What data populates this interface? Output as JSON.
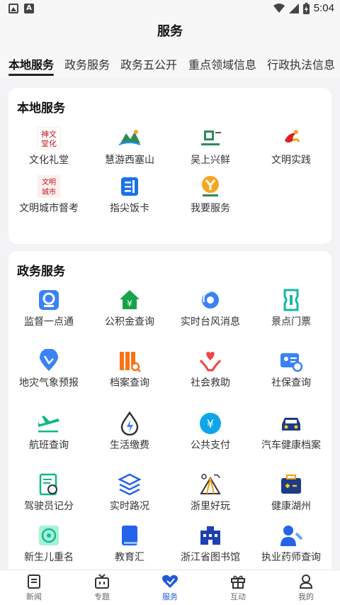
{
  "status": {
    "time": "5:04"
  },
  "header": {
    "title": "服务"
  },
  "tabs": [
    {
      "label": "本地服务"
    },
    {
      "label": "政务服务"
    },
    {
      "label": "政务五公开"
    },
    {
      "label": "重点领域信息"
    },
    {
      "label": "行政执法信息"
    }
  ],
  "local": {
    "title": "本地服务",
    "items": [
      {
        "label": "文化礼堂"
      },
      {
        "label": "慧游西塞山"
      },
      {
        "label": "吴上兴鲜"
      },
      {
        "label": "文明实践"
      },
      {
        "label": "文明城市督考"
      },
      {
        "label": "指尖饭卡"
      },
      {
        "label": "我要服务"
      }
    ]
  },
  "gov": {
    "title": "政务服务",
    "items": [
      {
        "label": "监督一点通"
      },
      {
        "label": "公积金查询"
      },
      {
        "label": "实时台风消息"
      },
      {
        "label": "景点门票"
      },
      {
        "label": "地灾气象预报"
      },
      {
        "label": "档案查询"
      },
      {
        "label": "社会救助"
      },
      {
        "label": "社保查询"
      },
      {
        "label": "航班查询"
      },
      {
        "label": "生活缴费"
      },
      {
        "label": "公共支付"
      },
      {
        "label": "汽车健康档案"
      },
      {
        "label": "驾驶员记分"
      },
      {
        "label": "实时路况"
      },
      {
        "label": "浙里好玩"
      },
      {
        "label": "健康湖州"
      },
      {
        "label": "新生儿重名"
      },
      {
        "label": "教育汇"
      },
      {
        "label": "浙江省图书馆"
      },
      {
        "label": "执业药师查询"
      }
    ]
  },
  "nav": [
    {
      "label": "新闻"
    },
    {
      "label": "专题"
    },
    {
      "label": "服务"
    },
    {
      "label": "互动"
    },
    {
      "label": "我的"
    }
  ],
  "colors": {
    "accent": "#1f5bd6",
    "background": "#f3f3f5"
  }
}
